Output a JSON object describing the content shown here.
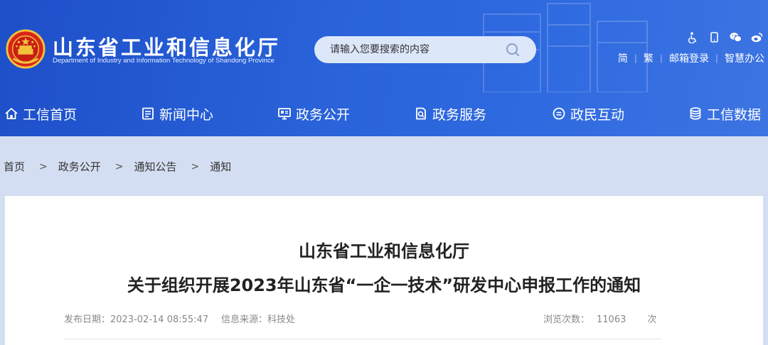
{
  "header": {
    "title": "山东省工业和信息化厅",
    "subtitle": "Department of Industry and Information Technology of Shandong Province",
    "search_placeholder": "请输入您要搜索的内容",
    "tool_icons": [
      "accessibility-icon",
      "mobile-icon",
      "wechat-icon",
      "weibo-icon"
    ],
    "links": {
      "simplified": "简",
      "traditional": "繁",
      "mail_login": "邮箱登录",
      "smart_office": "智慧办公"
    }
  },
  "nav": {
    "items": [
      {
        "label": "工信首页",
        "icon": "home-icon"
      },
      {
        "label": "新闻中心",
        "icon": "news-icon"
      },
      {
        "label": "政务公开",
        "icon": "monitor-icon"
      },
      {
        "label": "政务服务",
        "icon": "service-icon"
      },
      {
        "label": "政民互动",
        "icon": "chat-icon"
      },
      {
        "label": "工信数据",
        "icon": "database-icon"
      }
    ]
  },
  "breadcrumb": {
    "items": [
      "首页",
      "政务公开",
      "通知公告",
      "通知"
    ],
    "separator": ">"
  },
  "article": {
    "org": "山东省工业和信息化厅",
    "title": "关于组织开展2023年山东省“一企一技术”研发中心申报工作的通知",
    "publish_label": "发布日期：",
    "publish_date": "2023-02-14 08:55:47",
    "source_label": "信息来源：",
    "source": "科技处",
    "views_label": "浏览次数：",
    "views": "11063",
    "views_unit": "次"
  },
  "colors": {
    "header_blue": "#2a63da",
    "page_bg": "#d4def2",
    "search_bg": "#dde7fa"
  }
}
